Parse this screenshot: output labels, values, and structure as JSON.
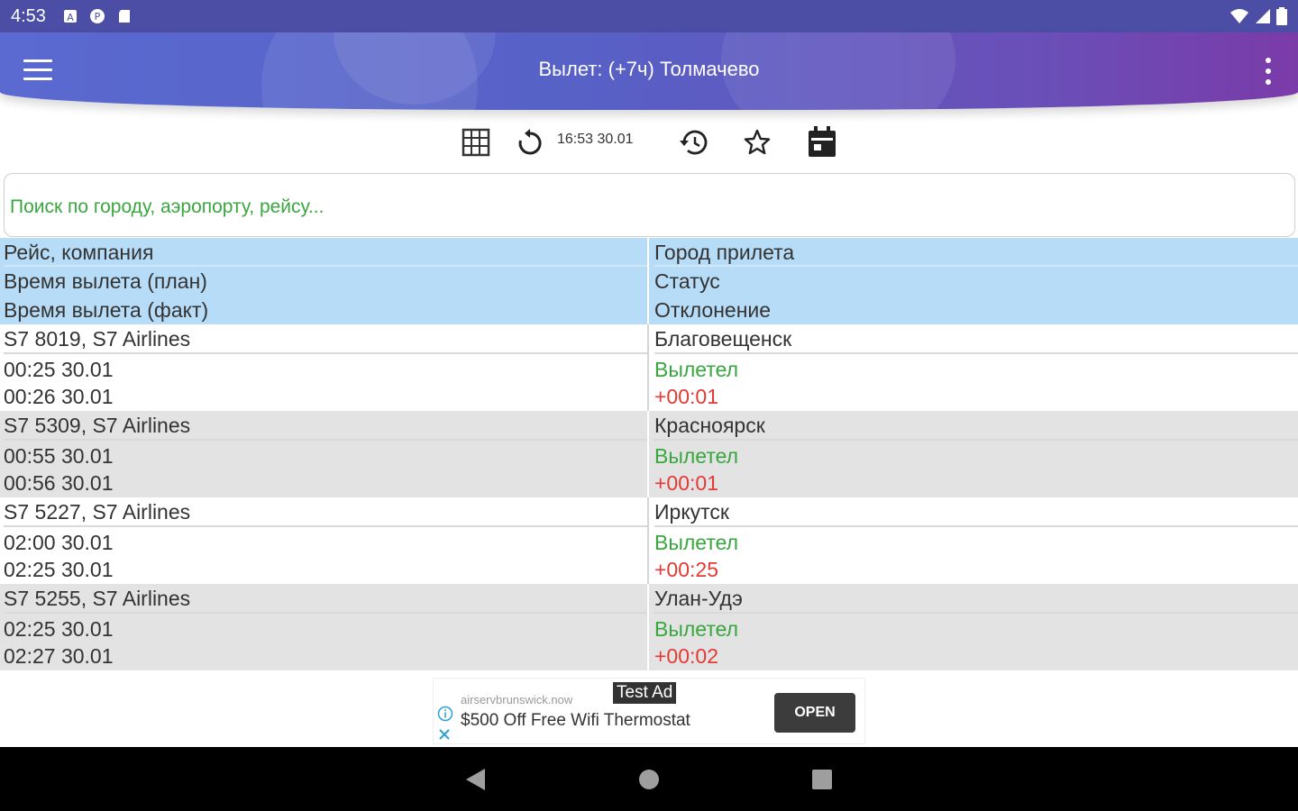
{
  "status_bar": {
    "time": "4:53",
    "left_icons": [
      "notification-a-icon",
      "notification-p-icon",
      "sd-card-icon"
    ],
    "right_icons": [
      "wifi-icon",
      "signal-icon",
      "battery-icon"
    ]
  },
  "app_bar": {
    "title": "Вылет: (+7ч) Толмачево",
    "menu_icon": "hamburger-menu-icon",
    "more_icon": "more-vert-icon"
  },
  "toolbar": {
    "update_time": "16:53 30.01",
    "icons": [
      "grid-icon",
      "refresh-icon",
      "history-icon",
      "star-icon",
      "calendar-icon"
    ]
  },
  "search": {
    "placeholder": "Поиск по городу, аэропорту, рейсу...",
    "value": ""
  },
  "table": {
    "header": {
      "flight_company": "Рейс, компания",
      "arrival_city": "Город прилета",
      "dep_planned": "Время вылета (план)",
      "dep_actual": "Время вылета (факт)",
      "status": "Статус",
      "deviation": "Отклонение"
    },
    "rows": [
      {
        "flight": "S7 8019, S7 Airlines",
        "city": "Благовещенск",
        "planned": "00:25 30.01",
        "actual": "00:26 30.01",
        "status": "Вылетел",
        "deviation": "+00:01"
      },
      {
        "flight": "S7 5309, S7 Airlines",
        "city": "Красноярск",
        "planned": "00:55 30.01",
        "actual": "00:56 30.01",
        "status": "Вылетел",
        "deviation": "+00:01"
      },
      {
        "flight": "S7 5227, S7 Airlines",
        "city": "Иркутск",
        "planned": "02:00 30.01",
        "actual": "02:25 30.01",
        "status": "Вылетел",
        "deviation": "+00:25"
      },
      {
        "flight": "S7 5255, S7 Airlines",
        "city": "Улан-Удэ",
        "planned": "02:25 30.01",
        "actual": "02:27 30.01",
        "status": "Вылетел",
        "deviation": "+00:02"
      }
    ]
  },
  "ad": {
    "domain": "airservbrunswick.now",
    "badge": "Test Ad",
    "text": "$500 Off Free Wifi Thermostat",
    "button": "OPEN"
  },
  "colors": {
    "status_green": "#3aa640",
    "deviation_red": "#e53935",
    "header_bg": "#b7dcf7",
    "row_gray": "#e3e3e3"
  },
  "nav_bar": {
    "icons": [
      "back-icon",
      "home-icon",
      "recents-icon"
    ]
  }
}
